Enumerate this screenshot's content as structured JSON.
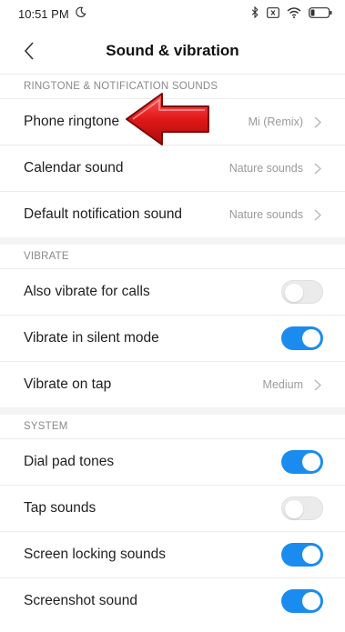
{
  "status": {
    "time": "10:51 PM"
  },
  "header": {
    "title": "Sound & vibration"
  },
  "sections": {
    "ringtone": {
      "header": "RINGTONE & NOTIFICATION SOUNDS",
      "items": [
        {
          "label": "Phone ringtone",
          "value": "Mi (Remix)"
        },
        {
          "label": "Calendar sound",
          "value": "Nature sounds"
        },
        {
          "label": "Default notification sound",
          "value": "Nature sounds"
        }
      ]
    },
    "vibrate": {
      "header": "VIBRATE",
      "items": [
        {
          "label": "Also vibrate for calls",
          "toggle": false
        },
        {
          "label": "Vibrate in silent mode",
          "toggle": true
        },
        {
          "label": "Vibrate on tap",
          "value": "Medium"
        }
      ]
    },
    "system": {
      "header": "SYSTEM",
      "items": [
        {
          "label": "Dial pad tones",
          "toggle": true
        },
        {
          "label": "Tap sounds",
          "toggle": false
        },
        {
          "label": "Screen locking sounds",
          "toggle": true
        },
        {
          "label": "Screenshot sound",
          "toggle": true
        }
      ]
    }
  },
  "colors": {
    "accent": "#1a8cf0",
    "arrow": "#d81a1a"
  },
  "icons": [
    "moon-icon",
    "bluetooth-icon",
    "sim-x-icon",
    "wifi-icon",
    "battery-icon",
    "back-icon",
    "chevron-right-icon",
    "red-arrow-icon"
  ]
}
